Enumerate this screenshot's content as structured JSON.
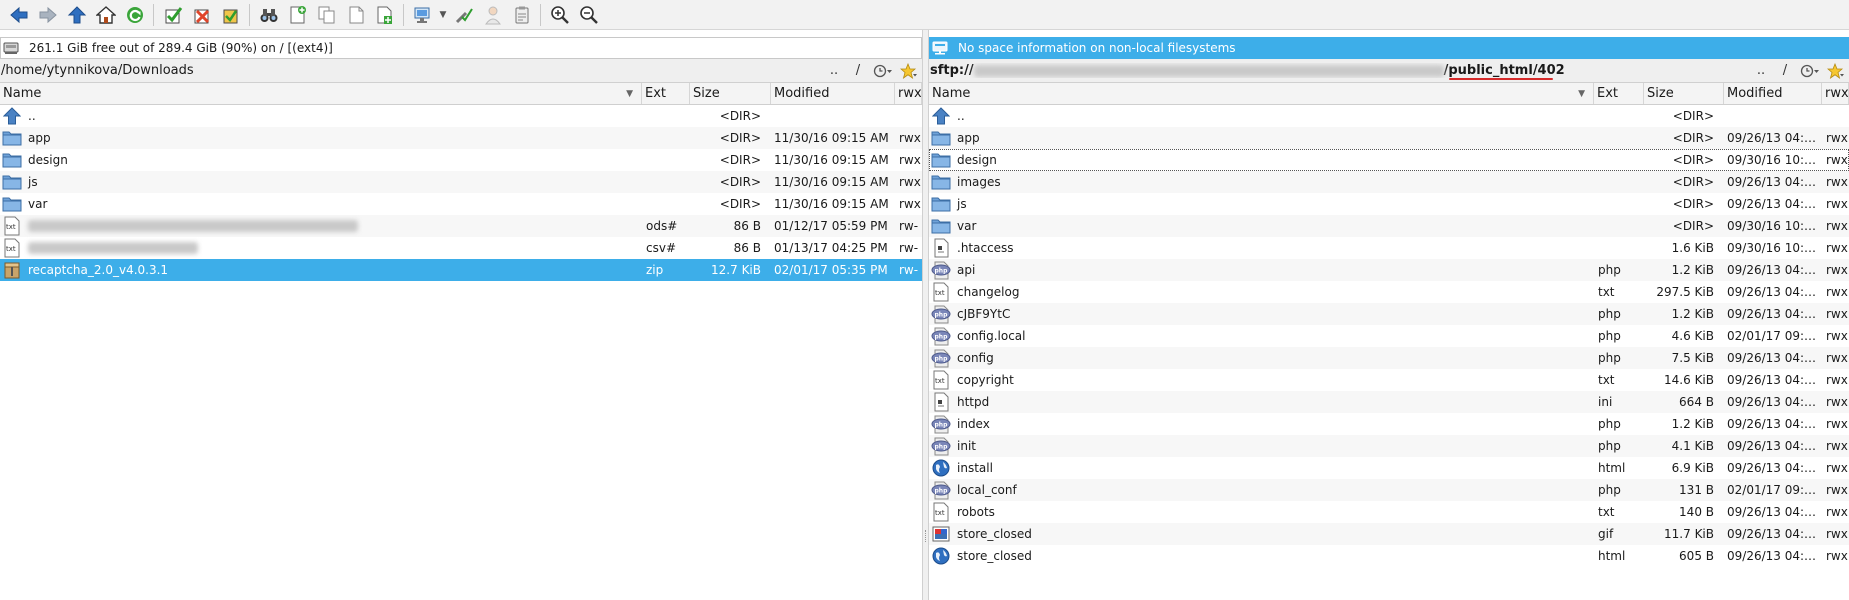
{
  "toolbar": {
    "buttons": [
      {
        "icon": "back-arrow-icon"
      },
      {
        "icon": "forward-arrow-icon"
      },
      {
        "icon": "up-arrow-icon"
      },
      {
        "icon": "home-icon"
      },
      {
        "icon": "refresh-icon"
      },
      {
        "icon": "select-all-icon"
      },
      {
        "icon": "unselect-icon"
      },
      {
        "icon": "invert-selection-icon"
      },
      {
        "icon": "binoculars-icon"
      },
      {
        "icon": "new-file-icon"
      },
      {
        "icon": "copy-icon"
      },
      {
        "icon": "blank-page-icon"
      },
      {
        "icon": "add-file-icon"
      },
      {
        "icon": "network-icon"
      },
      {
        "icon": "tools-icon"
      },
      {
        "icon": "person-icon"
      },
      {
        "icon": "clipboard-icon"
      },
      {
        "icon": "zoom-in-icon"
      },
      {
        "icon": "zoom-out-icon"
      }
    ]
  },
  "left": {
    "info": "261.1 GiB free out of 289.4 GiB (90%) on / [(ext4)]",
    "path": "/home/ytynnikova/Downloads",
    "path_up": "..",
    "path_root": "/",
    "columns": {
      "name": "Name",
      "ext": "Ext",
      "size": "Size",
      "modified": "Modified",
      "perm": "rwx"
    },
    "rows": [
      {
        "icon": "up-dir-icon",
        "name": "..",
        "ext": "",
        "size": "<DIR>",
        "modified": "",
        "perm": ""
      },
      {
        "icon": "folder-icon",
        "name": "app",
        "ext": "",
        "size": "<DIR>",
        "modified": "11/30/16 09:15 AM",
        "perm": "rwx"
      },
      {
        "icon": "folder-icon",
        "name": "design",
        "ext": "",
        "size": "<DIR>",
        "modified": "11/30/16 09:15 AM",
        "perm": "rwx"
      },
      {
        "icon": "folder-icon",
        "name": "js",
        "ext": "",
        "size": "<DIR>",
        "modified": "11/30/16 09:15 AM",
        "perm": "rwx"
      },
      {
        "icon": "folder-icon",
        "name": "var",
        "ext": "",
        "size": "<DIR>",
        "modified": "11/30/16 09:15 AM",
        "perm": "rwx"
      },
      {
        "icon": "text-file-icon",
        "name": "",
        "ext": "ods#",
        "size": "86 B",
        "modified": "01/12/17 05:59 PM",
        "perm": "rw-",
        "blur": 1
      },
      {
        "icon": "text-file-icon",
        "name": "",
        "ext": "csv#",
        "size": "86 B",
        "modified": "01/13/17 04:25 PM",
        "perm": "rw-",
        "blur": 2
      },
      {
        "icon": "archive-icon",
        "name": "recaptcha_2.0_v4.0.3.1",
        "ext": "zip",
        "size": "12.7 KiB",
        "modified": "02/01/17 05:35 PM",
        "perm": "rw-",
        "selected": true
      }
    ]
  },
  "right": {
    "info": "No space information on non-local filesystems",
    "path_prefix": "sftp://",
    "path_suffix": "/public_html/402",
    "path_up": "..",
    "path_root": "/",
    "columns": {
      "name": "Name",
      "ext": "Ext",
      "size": "Size",
      "modified": "Modified",
      "perm": "rwx"
    },
    "rows": [
      {
        "icon": "up-dir-icon",
        "name": "..",
        "ext": "",
        "size": "<DIR>",
        "modified": "",
        "perm": ""
      },
      {
        "icon": "folder-icon",
        "name": "app",
        "ext": "",
        "size": "<DIR>",
        "modified": "09/26/13 04:…",
        "perm": "rwx"
      },
      {
        "icon": "folder-icon",
        "name": "design",
        "ext": "",
        "size": "<DIR>",
        "modified": "09/30/16 10:…",
        "perm": "rwx",
        "focused": true
      },
      {
        "icon": "folder-icon",
        "name": "images",
        "ext": "",
        "size": "<DIR>",
        "modified": "09/26/13 04:…",
        "perm": "rwx"
      },
      {
        "icon": "folder-icon",
        "name": "js",
        "ext": "",
        "size": "<DIR>",
        "modified": "09/26/13 04:…",
        "perm": "rwx"
      },
      {
        "icon": "folder-icon",
        "name": "var",
        "ext": "",
        "size": "<DIR>",
        "modified": "09/30/16 10:…",
        "perm": "rwx"
      },
      {
        "icon": "config-file-icon",
        "name": ".htaccess",
        "ext": "",
        "size": "1.6 KiB",
        "modified": "09/30/16 10:…",
        "perm": "rwx"
      },
      {
        "icon": "php-file-icon",
        "name": "api",
        "ext": "php",
        "size": "1.2 KiB",
        "modified": "09/26/13 04:…",
        "perm": "rwx"
      },
      {
        "icon": "text-file-icon",
        "name": "changelog",
        "ext": "txt",
        "size": "297.5 KiB",
        "modified": "09/26/13 04:…",
        "perm": "rwx"
      },
      {
        "icon": "php-file-icon",
        "name": "cJBF9YtC",
        "ext": "php",
        "size": "1.2 KiB",
        "modified": "09/26/13 04:…",
        "perm": "rwx"
      },
      {
        "icon": "php-file-icon",
        "name": "config.local",
        "ext": "php",
        "size": "4.6 KiB",
        "modified": "02/01/17 09:…",
        "perm": "rwx"
      },
      {
        "icon": "php-file-icon",
        "name": "config",
        "ext": "php",
        "size": "7.5 KiB",
        "modified": "09/26/13 04:…",
        "perm": "rwx"
      },
      {
        "icon": "text-file-icon",
        "name": "copyright",
        "ext": "txt",
        "size": "14.6 KiB",
        "modified": "09/26/13 04:…",
        "perm": "rwx"
      },
      {
        "icon": "config-file-icon",
        "name": "httpd",
        "ext": "ini",
        "size": "664 B",
        "modified": "09/26/13 04:…",
        "perm": "rwx"
      },
      {
        "icon": "php-file-icon",
        "name": "index",
        "ext": "php",
        "size": "1.2 KiB",
        "modified": "09/26/13 04:…",
        "perm": "rwx"
      },
      {
        "icon": "php-file-icon",
        "name": "init",
        "ext": "php",
        "size": "4.1 KiB",
        "modified": "09/26/13 04:…",
        "perm": "rwx"
      },
      {
        "icon": "globe-icon",
        "name": "install",
        "ext": "html",
        "size": "6.9 KiB",
        "modified": "09/26/13 04:…",
        "perm": "rwx"
      },
      {
        "icon": "php-file-icon",
        "name": "local_conf",
        "ext": "php",
        "size": "131 B",
        "modified": "02/01/17 09:…",
        "perm": "rwx"
      },
      {
        "icon": "text-file-icon",
        "name": "robots",
        "ext": "txt",
        "size": "140 B",
        "modified": "09/26/13 04:…",
        "perm": "rwx"
      },
      {
        "icon": "image-file-icon",
        "name": "store_closed",
        "ext": "gif",
        "size": "11.7 KiB",
        "modified": "09/26/13 04:…",
        "perm": "rwx"
      },
      {
        "icon": "globe-icon",
        "name": "store_closed",
        "ext": "html",
        "size": "605 B",
        "modified": "09/26/13 04:…",
        "perm": "rwx"
      }
    ]
  }
}
